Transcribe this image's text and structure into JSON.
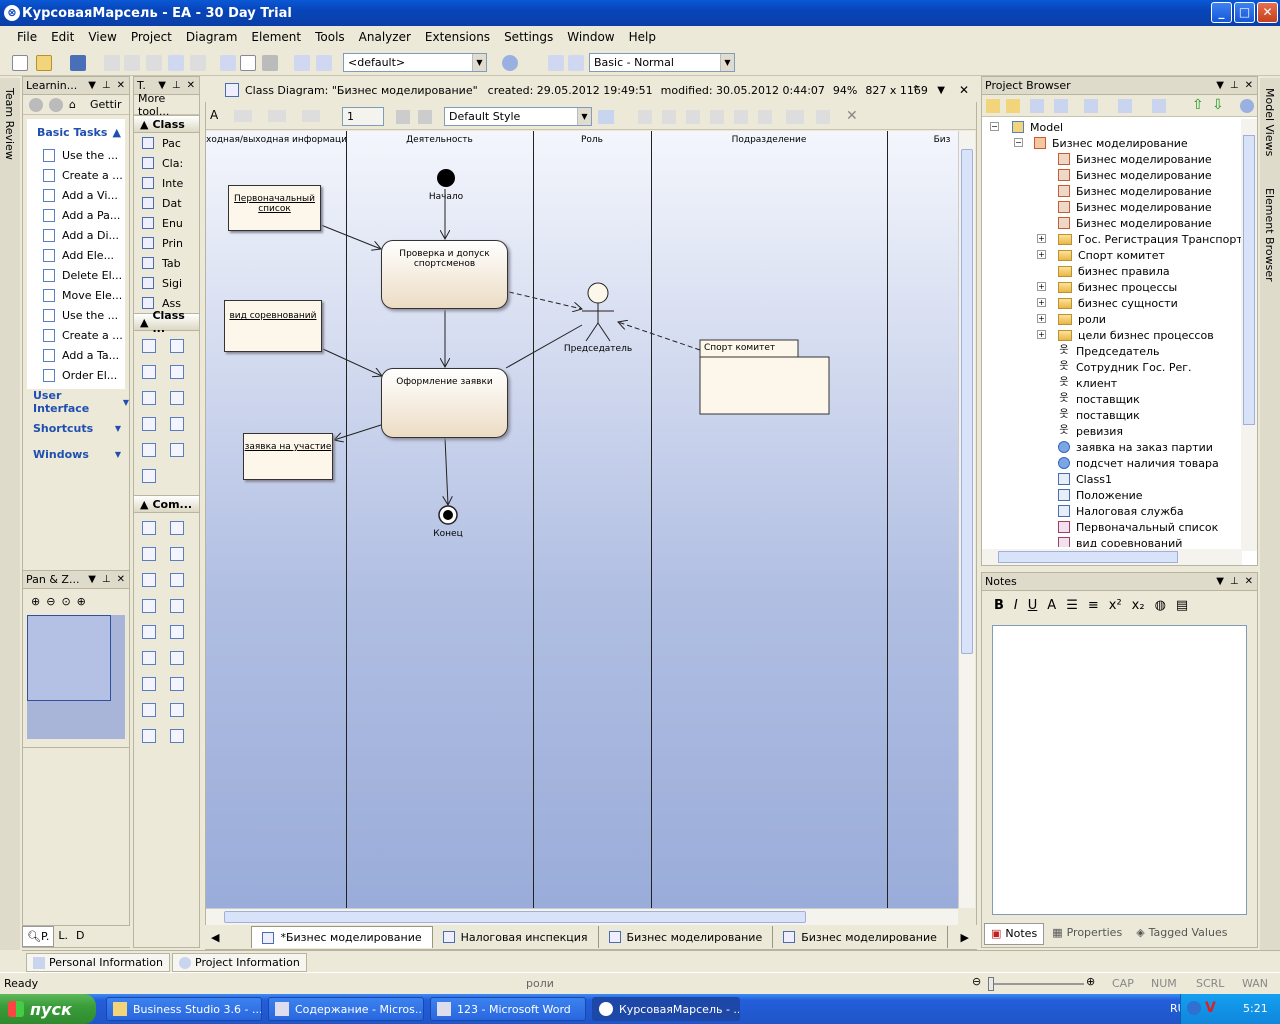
{
  "window": {
    "title": "КурсоваяМарсель - EA - 30 Day Trial",
    "min": "_",
    "max": "□",
    "close": "✕"
  },
  "menu": [
    "File",
    "Edit",
    "View",
    "Project",
    "Diagram",
    "Element",
    "Tools",
    "Analyzer",
    "Extensions",
    "Settings",
    "Window",
    "Help"
  ],
  "toolbar": {
    "view_combo": "<default>",
    "workspace_combo": "Basic - Normal"
  },
  "learning": {
    "title": "Learnin...",
    "tab": "Gettir",
    "section": "Basic Tasks",
    "tasks": [
      "Use the ...",
      "Create a ...",
      "Add a Vi...",
      "Add a Pa...",
      "Add a Di...",
      "Add Ele...",
      "Delete El...",
      "Move Ele...",
      "Use the ...",
      "Create a ...",
      "Add a Ta...",
      "Order El..."
    ],
    "links": [
      "User Interface",
      "Shortcuts",
      "Windows"
    ]
  },
  "panzoom": {
    "title": "Pan & Z..."
  },
  "lefttabs": [
    "P.",
    "L.",
    "D"
  ],
  "left_vertical": "Team Review",
  "toolbox": {
    "title": "T.",
    "more": "More tool...",
    "group1": "Class",
    "items": [
      "Pac",
      "Cla:",
      "Inte",
      "Dat",
      "Enu",
      "Prin",
      "Tab",
      "Sigi",
      "Ass"
    ],
    "group2": "Class ...",
    "group3": "Com..."
  },
  "diagram": {
    "title": "Class Diagram: \"Бизнес моделирование\"",
    "created": "created: 29.05.2012 19:49:51",
    "modified": "modified: 30.05.2012 0:44:07",
    "zoom": "94%",
    "size": "827 x 1169",
    "style_combo": "Default Style",
    "line_width": "1",
    "lanes": [
      "ходная/выходная  информация",
      "Деятельность",
      "Роль",
      "Подразделение",
      "Биз"
    ],
    "notes": {
      "n1": "Первоначальный список",
      "n2": "вид соревнований",
      "n3": "заявка на участие"
    },
    "activities": {
      "a1": "Проверка и допуск спортсменов",
      "a2": "Оформление заявки"
    },
    "start_label": "Начало",
    "end_label": "Конец",
    "actor_label": "Председатель",
    "package_label": "Спорт комитет"
  },
  "diagram_tabs": [
    "*Бизнес моделирование",
    "Налоговая инспекция",
    "Бизнес моделирование",
    "Бизнес моделирование"
  ],
  "project_browser": {
    "title": "Project Browser",
    "root": "Model",
    "package": "Бизнес моделирование",
    "items": [
      {
        "label": "Бизнес моделирование",
        "kind": "diagram",
        "expand": false
      },
      {
        "label": "Бизнес моделирование",
        "kind": "diagram",
        "expand": false
      },
      {
        "label": "Бизнес моделирование",
        "kind": "diagram",
        "expand": false
      },
      {
        "label": "Бизнес моделирование",
        "kind": "diagram",
        "expand": false
      },
      {
        "label": "Бизнес моделирование",
        "kind": "diagram",
        "expand": false
      },
      {
        "label": "Гос. Регистрация Транспортных",
        "kind": "folder",
        "expand": true
      },
      {
        "label": "Спорт комитет",
        "kind": "folder",
        "expand": true
      },
      {
        "label": "бизнес правила",
        "kind": "folder",
        "expand": false
      },
      {
        "label": "бизнес процессы",
        "kind": "folder",
        "expand": true
      },
      {
        "label": "бизнес сущности",
        "kind": "folder",
        "expand": true
      },
      {
        "label": "роли",
        "kind": "folder",
        "expand": true
      },
      {
        "label": "цели бизнес процессов",
        "kind": "folder",
        "expand": true
      },
      {
        "label": "Председатель",
        "kind": "actor",
        "expand": false
      },
      {
        "label": "Сотрудник Гос. Рег.",
        "kind": "actor",
        "expand": false
      },
      {
        "label": "клиент",
        "kind": "actor",
        "expand": false
      },
      {
        "label": "поставщик",
        "kind": "actor",
        "expand": false
      },
      {
        "label": "поставщик",
        "kind": "actor",
        "expand": false
      },
      {
        "label": "ревизия",
        "kind": "actor",
        "expand": false
      },
      {
        "label": "заявка на заказ партии",
        "kind": "usecase",
        "expand": false
      },
      {
        "label": "подсчет наличия товара",
        "kind": "usecase",
        "expand": false
      },
      {
        "label": "Class1",
        "kind": "class",
        "expand": false
      },
      {
        "label": "Положение",
        "kind": "class",
        "expand": false
      },
      {
        "label": "Налоговая служба",
        "kind": "class",
        "expand": false
      },
      {
        "label": "Первоначальный список",
        "kind": "note",
        "expand": false
      },
      {
        "label": "вид соревнований",
        "kind": "note",
        "expand": false
      }
    ]
  },
  "notes_panel": {
    "title": "Notes",
    "tabs": [
      "Notes",
      "Properties",
      "Tagged Values"
    ]
  },
  "right_vertical": [
    "Model Views",
    "Element Browser"
  ],
  "bottom_tabs": [
    "Personal Information",
    "Project Information"
  ],
  "status": {
    "left": "Ready",
    "center": "роли",
    "caps": "CAP",
    "num": "NUM",
    "scrl": "SCRL",
    "wan": "WAN"
  },
  "taskbar": {
    "start": "пуск",
    "buttons": [
      "Business Studio 3.6 - ...",
      "Содержание - Micros...",
      "123 - Microsoft Word",
      "КурсоваяМарсель - ..."
    ],
    "lang": "RU",
    "clock": "5:21"
  }
}
